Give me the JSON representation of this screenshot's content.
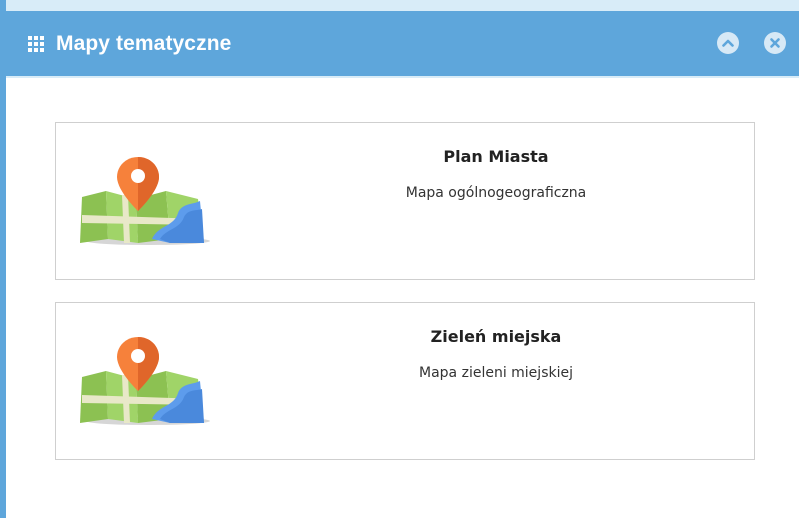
{
  "window": {
    "title": "Mapy tematyczne",
    "title_icon": "grid-icon",
    "controls": [
      {
        "name": "collapse-button",
        "icon": "chevron-up-icon"
      },
      {
        "name": "close-button",
        "icon": "close-icon"
      }
    ],
    "colors": {
      "header": "#5ea6db",
      "header_text": "#ffffff",
      "card_border": "#cfcfcf"
    }
  },
  "maps": [
    {
      "title": "Plan Miasta",
      "subtitle": "Mapa ogólnogeograficzna",
      "icon": "map-pin-icon"
    },
    {
      "title": "Zieleń miejska",
      "subtitle": "Mapa zieleni miejskiej",
      "icon": "map-pin-icon"
    }
  ]
}
